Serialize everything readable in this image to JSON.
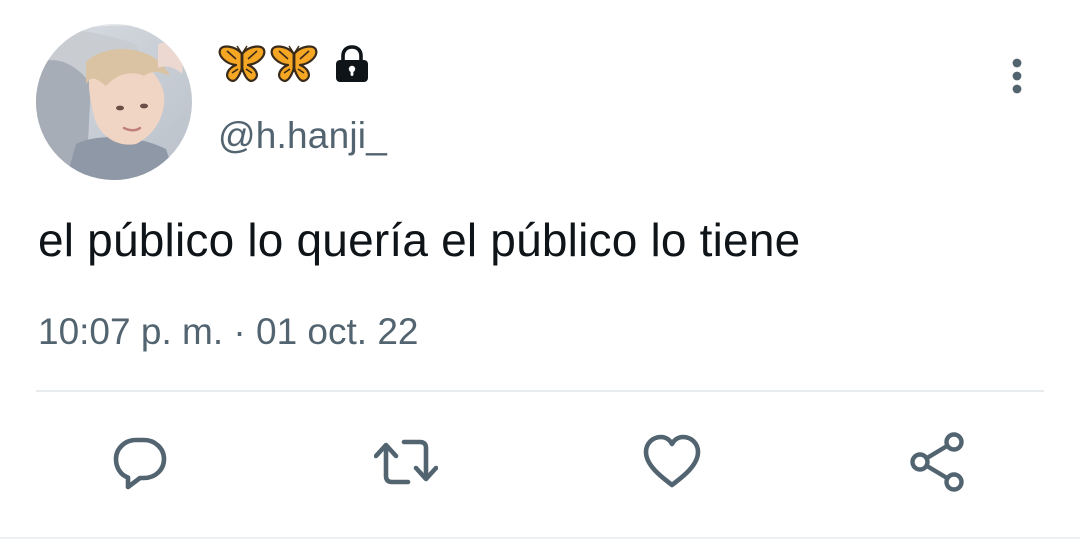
{
  "tweet": {
    "author": {
      "display_name": "🦋🦋🔒",
      "display_icons": [
        "butterfly-icon",
        "butterfly-icon",
        "lock-icon"
      ],
      "handle": "@h.hanji_"
    },
    "text": "el público lo quería el público lo tiene",
    "timestamp": "10:07 p. m. · 01 oct. 22"
  },
  "actions": [
    "reply-icon",
    "retweet-icon",
    "like-icon",
    "share-icon"
  ],
  "colors": {
    "text_primary": "#0f1419",
    "text_secondary": "#536471",
    "icon": "#536471",
    "divider": "#e8ecef"
  }
}
